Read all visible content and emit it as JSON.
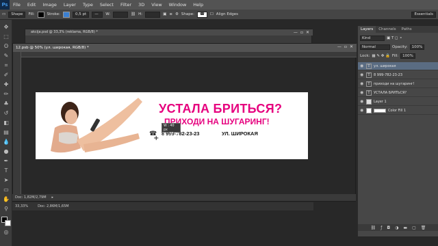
{
  "menu": {
    "logo": "Ps",
    "items": [
      "File",
      "Edit",
      "Image",
      "Layer",
      "Type",
      "Select",
      "Filter",
      "3D",
      "View",
      "Window",
      "Help"
    ]
  },
  "options": {
    "mode": "Shape",
    "fill_label": "Fill:",
    "stroke_label": "Stroke:",
    "stroke_width": "0,5 pt",
    "w_label": "W:",
    "h_label": "H:",
    "shape_label": "Shape:",
    "align_edges": "Align Edges",
    "workspace": "Essentials"
  },
  "bg_document": {
    "title": "akcija.psd @ 33,3% (reklama, RGB/8) *"
  },
  "document": {
    "title": "12.psb @ 50% (ул. широкая, RGB/8) *",
    "status": "Doc: 1,82M/2,79M"
  },
  "bottom_status": {
    "zoom": "33,33%",
    "doc": "Doc: 2,86M/1,65M"
  },
  "canvas": {
    "headline": "УСТАЛА БРИТЬСЯ?",
    "subline": "ПРИХОДИ НА ШУГАРИНГ!",
    "phone": "8 999-782-23-23",
    "street": "УЛ. ШИРОКАЯ",
    "accent": "#e6007e"
  },
  "tooltip": {
    "w": "W : 40 px",
    "h": "H : 28 px"
  },
  "panel": {
    "tabs": [
      "Layers",
      "Channels",
      "Paths"
    ],
    "kind": "Kind",
    "blend": "Normal",
    "opacity_label": "Opacity:",
    "opacity": "100%",
    "lock_label": "Lock:",
    "fill_label": "Fill:",
    "fill": "100%",
    "layers": [
      {
        "name": "ул. широкая",
        "type": "T"
      },
      {
        "name": "8 999-782-23-23",
        "type": "T"
      },
      {
        "name": "приходи на шугаринг!",
        "type": "T"
      },
      {
        "name": "УСТАЛА БРИТЬСЯ?",
        "type": "T"
      },
      {
        "name": "Layer 1",
        "type": "img"
      },
      {
        "name": "Color Fill 1",
        "type": "fill"
      }
    ]
  }
}
